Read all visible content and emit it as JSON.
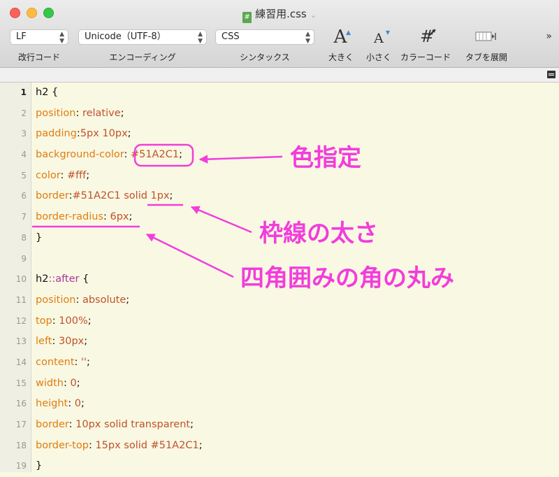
{
  "window": {
    "title": "練習用.css"
  },
  "toolbar": {
    "line_ending": {
      "value": "LF",
      "label": "改行コード"
    },
    "encoding": {
      "value": "Unicode（UTF-8）",
      "label": "エンコーディング"
    },
    "syntax": {
      "value": "CSS",
      "label": "シンタックス"
    },
    "bigger": {
      "label": "大きく",
      "glyph": "A"
    },
    "smaller": {
      "label": "小さく",
      "glyph": "A"
    },
    "color_code": {
      "label": "カラーコード",
      "glyph": "#"
    },
    "expand_tab": {
      "label": "タブを展開"
    },
    "overflow": "»"
  },
  "editor": {
    "line_numbers": [
      "1",
      "2",
      "3",
      "4",
      "5",
      "6",
      "7",
      "8",
      "9",
      "10",
      "11",
      "12",
      "13",
      "14",
      "15",
      "16",
      "17",
      "18",
      "19"
    ],
    "lines": [
      [
        {
          "t": "h2 {",
          "c": "plain"
        }
      ],
      [
        {
          "t": "position",
          "c": "prop"
        },
        {
          "t": ": ",
          "c": "plain"
        },
        {
          "t": "relative",
          "c": "val"
        },
        {
          "t": ";",
          "c": "plain"
        }
      ],
      [
        {
          "t": "padding",
          "c": "prop"
        },
        {
          "t": ":",
          "c": "plain"
        },
        {
          "t": "5px 10px",
          "c": "val"
        },
        {
          "t": ";",
          "c": "plain"
        }
      ],
      [
        {
          "t": "background-color",
          "c": "prop"
        },
        {
          "t": ": ",
          "c": "plain"
        },
        {
          "t": "#51A2C1",
          "c": "val"
        },
        {
          "t": ";",
          "c": "plain"
        }
      ],
      [
        {
          "t": "color",
          "c": "prop"
        },
        {
          "t": ": ",
          "c": "plain"
        },
        {
          "t": "#fff",
          "c": "val"
        },
        {
          "t": ";",
          "c": "plain"
        }
      ],
      [
        {
          "t": "border",
          "c": "prop"
        },
        {
          "t": ":",
          "c": "plain"
        },
        {
          "t": "#51A2C1 ",
          "c": "val"
        },
        {
          "t": "solid",
          "c": "val"
        },
        {
          "t": " 1px",
          "c": "val"
        },
        {
          "t": ";",
          "c": "plain"
        }
      ],
      [
        {
          "t": "border-radius",
          "c": "prop"
        },
        {
          "t": ": ",
          "c": "plain"
        },
        {
          "t": "6px",
          "c": "val"
        },
        {
          "t": ";",
          "c": "plain"
        }
      ],
      [
        {
          "t": "}",
          "c": "plain"
        }
      ],
      [],
      [
        {
          "t": "h2",
          "c": "plain"
        },
        {
          "t": "::after",
          "c": "pseudo"
        },
        {
          "t": " {",
          "c": "plain"
        }
      ],
      [
        {
          "t": "position",
          "c": "prop"
        },
        {
          "t": ": ",
          "c": "plain"
        },
        {
          "t": "absolute",
          "c": "val"
        },
        {
          "t": ";",
          "c": "plain"
        }
      ],
      [
        {
          "t": "top",
          "c": "prop"
        },
        {
          "t": ": ",
          "c": "plain"
        },
        {
          "t": "100%",
          "c": "val"
        },
        {
          "t": ";",
          "c": "plain"
        }
      ],
      [
        {
          "t": "left",
          "c": "prop"
        },
        {
          "t": ": ",
          "c": "plain"
        },
        {
          "t": "30px",
          "c": "val"
        },
        {
          "t": ";",
          "c": "plain"
        }
      ],
      [
        {
          "t": "content",
          "c": "prop"
        },
        {
          "t": ": ",
          "c": "plain"
        },
        {
          "t": "''",
          "c": "val"
        },
        {
          "t": ";",
          "c": "plain"
        }
      ],
      [
        {
          "t": "width",
          "c": "prop"
        },
        {
          "t": ": ",
          "c": "plain"
        },
        {
          "t": "0",
          "c": "val"
        },
        {
          "t": ";",
          "c": "plain"
        }
      ],
      [
        {
          "t": "height",
          "c": "prop"
        },
        {
          "t": ": ",
          "c": "plain"
        },
        {
          "t": "0",
          "c": "val"
        },
        {
          "t": ";",
          "c": "plain"
        }
      ],
      [
        {
          "t": "border",
          "c": "prop"
        },
        {
          "t": ": ",
          "c": "plain"
        },
        {
          "t": "10px solid transparent",
          "c": "val"
        },
        {
          "t": ";",
          "c": "plain"
        }
      ],
      [
        {
          "t": "border-top",
          "c": "prop"
        },
        {
          "t": ": ",
          "c": "plain"
        },
        {
          "t": "15px solid #51A2C1",
          "c": "val"
        },
        {
          "t": ";",
          "c": "plain"
        }
      ],
      [
        {
          "t": "}",
          "c": "plain"
        }
      ]
    ]
  },
  "annotations": {
    "color": "#f23ddb",
    "color_spec": "色指定",
    "border_width": "枠線の太さ",
    "corner_radius": "四角囲みの角の丸み"
  },
  "colors": {
    "property": "#e07d10",
    "value": "#c0522a",
    "pseudo": "#a7389a",
    "editor_bg": "#f9f8e3"
  }
}
